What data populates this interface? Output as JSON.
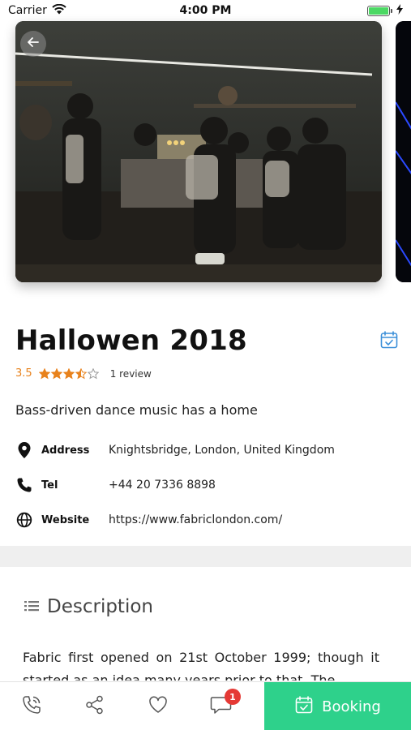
{
  "status_bar": {
    "carrier": "Carrier",
    "time": "4:00 PM"
  },
  "event": {
    "title": "Hallowen 2018",
    "rating": "3.5",
    "rating_stars": 3.5,
    "rating_max": 5,
    "review_count": "1 review",
    "tagline": "Bass-driven dance music has a home"
  },
  "info": [
    {
      "icon": "location-pin-icon",
      "label": "Address",
      "value": "Knightsbridge, London, United Kingdom"
    },
    {
      "icon": "phone-icon",
      "label": "Tel",
      "value": "+44 20 7336 8898"
    },
    {
      "icon": "globe-icon",
      "label": "Website",
      "value": "https://www.fabriclondon.com/"
    }
  ],
  "description": {
    "title": "Description",
    "text": "Fabric first opened on 21st October 1999; though it started as an idea many years prior to that. The"
  },
  "bottom_bar": {
    "icons": [
      "phone-call-icon",
      "share-icon",
      "heart-icon",
      "chat-icon"
    ],
    "chat_badge": "1",
    "booking_label": "Booking"
  },
  "colors": {
    "accent_green": "#2ed18b",
    "rating_orange": "#e8821c",
    "calendar_blue": "#3b8fd9",
    "badge_red": "#e53935"
  }
}
